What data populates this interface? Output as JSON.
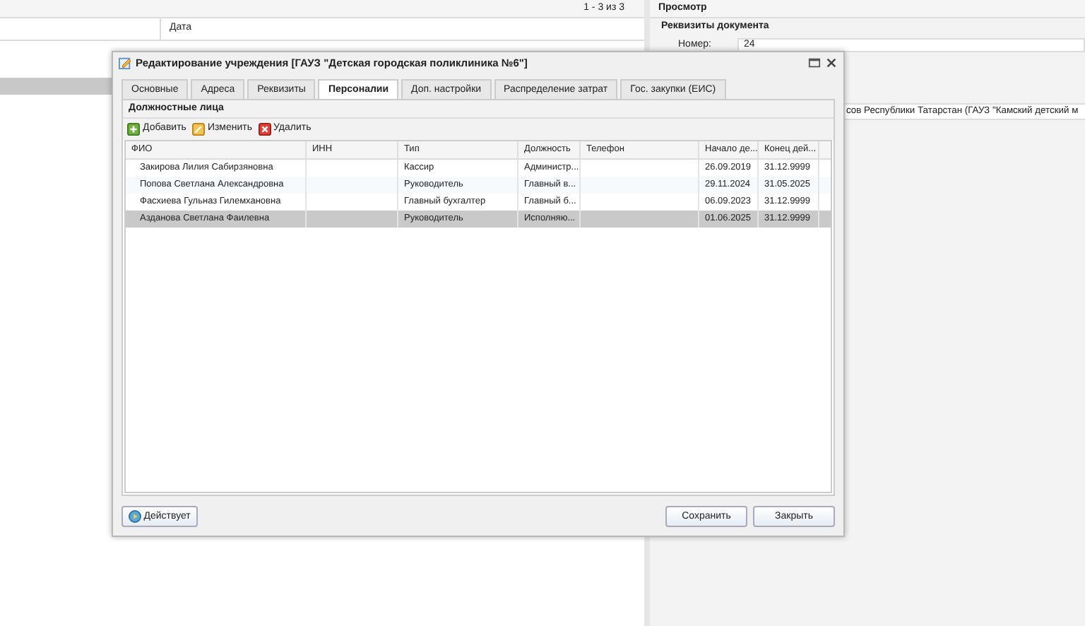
{
  "list_panel": {
    "pager": "1 - 3 из 3",
    "columns": [
      "",
      "Дата"
    ],
    "selected_row": true
  },
  "preview_panel": {
    "title": "Просмотр",
    "section": "Реквизиты документа",
    "number_label": "Номер:",
    "number_value": "24",
    "org_text": "сов Республики Татарстан (ГАУЗ \"Камский детский м"
  },
  "dialog": {
    "title": "Редактирование учреждения [ГАУЗ \"Детская городская поликлиника №6\"]",
    "tabs": [
      {
        "label": "Основные",
        "selected": false
      },
      {
        "label": "Адреса",
        "selected": false
      },
      {
        "label": "Реквизиты",
        "selected": false
      },
      {
        "label": "Персоналии",
        "selected": true
      },
      {
        "label": "Доп. настройки",
        "selected": false
      },
      {
        "label": "Распределение затрат",
        "selected": false
      },
      {
        "label": "Гос. закупки (ЕИС)",
        "selected": false
      }
    ],
    "section_title": "Должностные лица",
    "toolbar": [
      {
        "label": "Добавить",
        "kind": "add"
      },
      {
        "label": "Изменить",
        "kind": "edit"
      },
      {
        "label": "Удалить",
        "kind": "delete"
      }
    ],
    "table": {
      "columns": [
        "ФИО",
        "ИНН",
        "Тип",
        "Должность",
        "Телефон",
        "Начало де...",
        "Конец дей..."
      ],
      "rows": [
        {
          "cells": [
            "Закирова Лилия Сабирзяновна",
            "",
            "Кассир",
            "Администр...",
            "",
            "26.09.2019",
            "31.12.9999"
          ],
          "selected": false
        },
        {
          "cells": [
            "Попова Светлана Александровна",
            "",
            "Руководитель",
            "Главный в...",
            "",
            "29.11.2024",
            "31.05.2025"
          ],
          "selected": false
        },
        {
          "cells": [
            "Фасхиева Гульназ Гилемхановна",
            "",
            "Главный бухгалтер",
            "Главный б...",
            "",
            "06.09.2023",
            "31.12.9999"
          ],
          "selected": false
        },
        {
          "cells": [
            "Азданова Светлана Фаилевна",
            "",
            "Руководитель",
            "Исполняю...",
            "",
            "01.06.2025",
            "31.12.9999"
          ],
          "selected": true
        }
      ]
    },
    "status_button": "Действует",
    "buttons": [
      "Сохранить",
      "Закрыть"
    ]
  }
}
